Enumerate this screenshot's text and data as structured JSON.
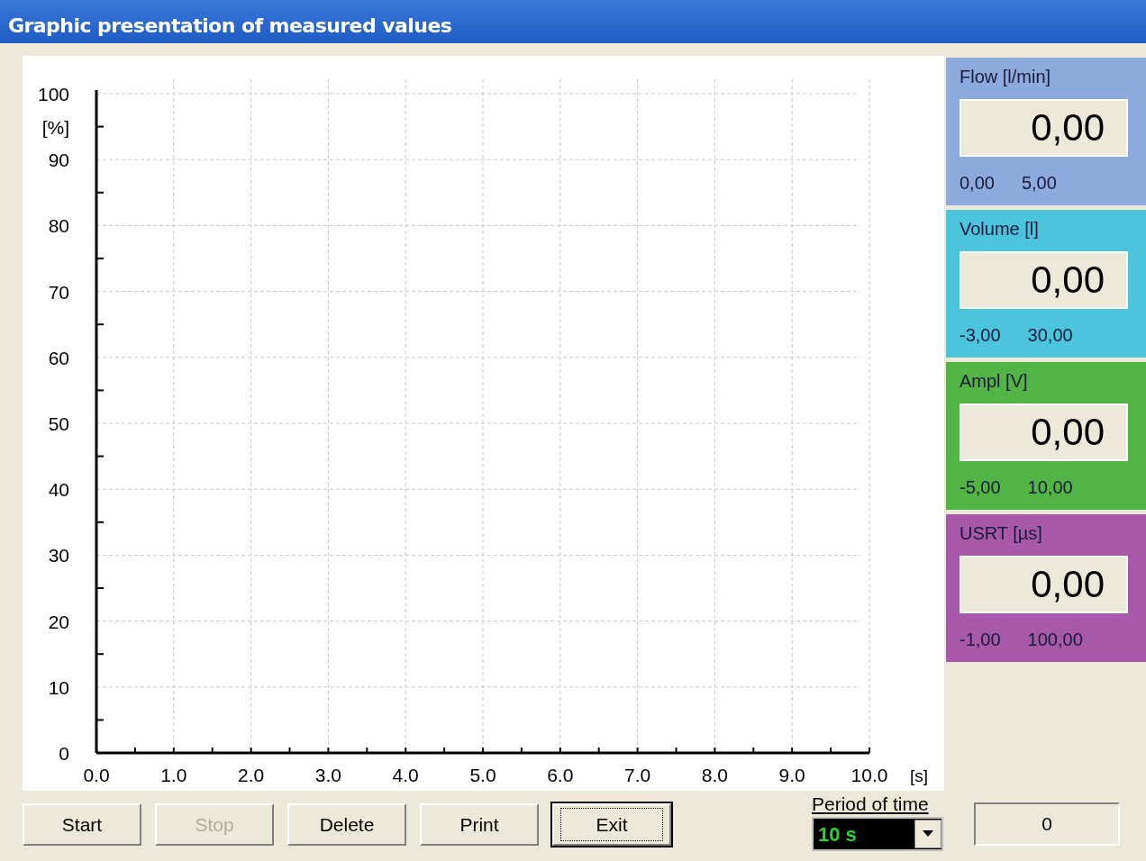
{
  "window": {
    "title": "Graphic presentation of measured values"
  },
  "chart": {
    "chart_data": {
      "type": "line",
      "grid": true,
      "ylabel": "[%]",
      "xlabel": "[s]",
      "xlim": [
        0,
        10
      ],
      "ylim": [
        0,
        100
      ],
      "xticks": [
        {
          "value": 0,
          "label": "0.0"
        },
        {
          "value": 1,
          "label": "1.0"
        },
        {
          "value": 2,
          "label": "2.0"
        },
        {
          "value": 3,
          "label": "3.0"
        },
        {
          "value": 4,
          "label": "4.0"
        },
        {
          "value": 5,
          "label": "5.0"
        },
        {
          "value": 6,
          "label": "6.0"
        },
        {
          "value": 7,
          "label": "7.0"
        },
        {
          "value": 8,
          "label": "8.0"
        },
        {
          "value": 9,
          "label": "9.0"
        },
        {
          "value": 10,
          "label": "10.0"
        }
      ],
      "yticks": [
        0,
        10,
        20,
        30,
        40,
        50,
        60,
        70,
        80,
        90,
        100
      ]
    }
  },
  "meters": [
    {
      "label": "Flow [l/min]",
      "value": "0,00",
      "min": "0,00",
      "max": "5,00",
      "color": "#8eaadc"
    },
    {
      "label": "Volume [l]",
      "value": "0,00",
      "min": "-3,00",
      "max": "30,00",
      "color": "#4cc4dc"
    },
    {
      "label": "Ampl [V]",
      "value": "0,00",
      "min": "-5,00",
      "max": "10,00",
      "color": "#52b444"
    },
    {
      "label": "USRT [µs]",
      "value": "0,00",
      "min": "-1,00",
      "max": "100,00",
      "color": "#a858a8"
    }
  ],
  "buttons": [
    {
      "label": "Start",
      "disabled": false,
      "focused": false
    },
    {
      "label": "Stop",
      "disabled": true,
      "focused": false
    },
    {
      "label": "Delete",
      "disabled": false,
      "focused": false
    },
    {
      "label": "Print",
      "disabled": false,
      "focused": false
    },
    {
      "label": "Exit",
      "disabled": false,
      "focused": true
    }
  ],
  "period": {
    "label": "Period of time",
    "value": "10 s"
  },
  "counter": "0"
}
